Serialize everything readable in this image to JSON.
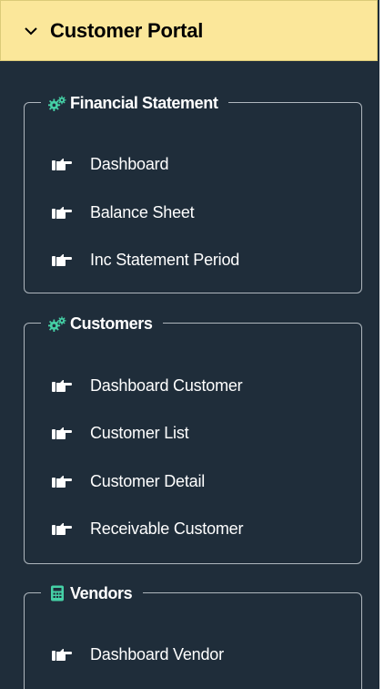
{
  "header": {
    "title": "Customer Portal",
    "icon": "chevron-down-icon"
  },
  "groups": [
    {
      "title": "Financial Statement",
      "icon": "gears-icon",
      "items": [
        {
          "label": "Dashboard"
        },
        {
          "label": "Balance Sheet"
        },
        {
          "label": "Inc Statement Period"
        }
      ]
    },
    {
      "title": "Customers",
      "icon": "gears-icon",
      "items": [
        {
          "label": "Dashboard Customer"
        },
        {
          "label": "Customer List"
        },
        {
          "label": "Customer Detail"
        },
        {
          "label": "Receivable Customer"
        }
      ]
    },
    {
      "title": "Vendors",
      "icon": "calculator-icon",
      "items": [
        {
          "label": "Dashboard Vendor"
        }
      ]
    }
  ],
  "colors": {
    "header_bg": "#fbe79a",
    "panel_bg": "#1f2d3a",
    "accent_icon": "#45d1a6",
    "text": "#ffffff"
  }
}
